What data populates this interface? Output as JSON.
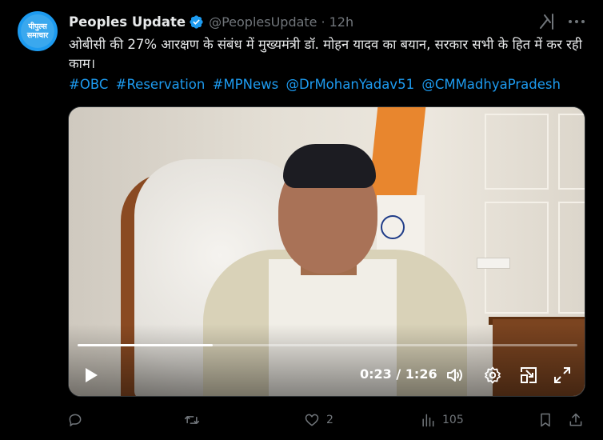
{
  "author": {
    "display_name": "Peoples Update",
    "handle": "@PeoplesUpdate",
    "separator": "·",
    "time": "12h",
    "avatar_text_line1": "पीपुल्स",
    "avatar_text_line2": "समाचार",
    "verified": true
  },
  "tweet": {
    "text": "ओबीसी की 27% आरक्षण के संबंध में मुख्यमंत्री डॉ. मोहन यादव का बयान, सरकार सभी के हित में कर रही काम।",
    "hashtags": [
      "#OBC",
      "#Reservation",
      "#MPNews",
      "@DrMohanYadav51",
      "@CMMadhyaPradesh"
    ]
  },
  "video": {
    "current_time": "0:23",
    "duration": "1:26",
    "time_separator": " / ",
    "progress_fraction": 0.27
  },
  "actions": {
    "reply_count": "",
    "retweet_count": "",
    "like_count": "2",
    "views_count": "105"
  },
  "colors": {
    "accent": "#1d9bf0",
    "muted": "#71767b",
    "text": "#e7e9ea",
    "background": "#000000"
  },
  "icons": [
    "verified-badge-icon",
    "grok-icon",
    "more-icon",
    "play-icon",
    "volume-icon",
    "settings-icon",
    "pip-icon",
    "fullscreen-icon",
    "reply-icon",
    "retweet-icon",
    "like-icon",
    "views-icon",
    "bookmark-icon",
    "share-icon"
  ]
}
